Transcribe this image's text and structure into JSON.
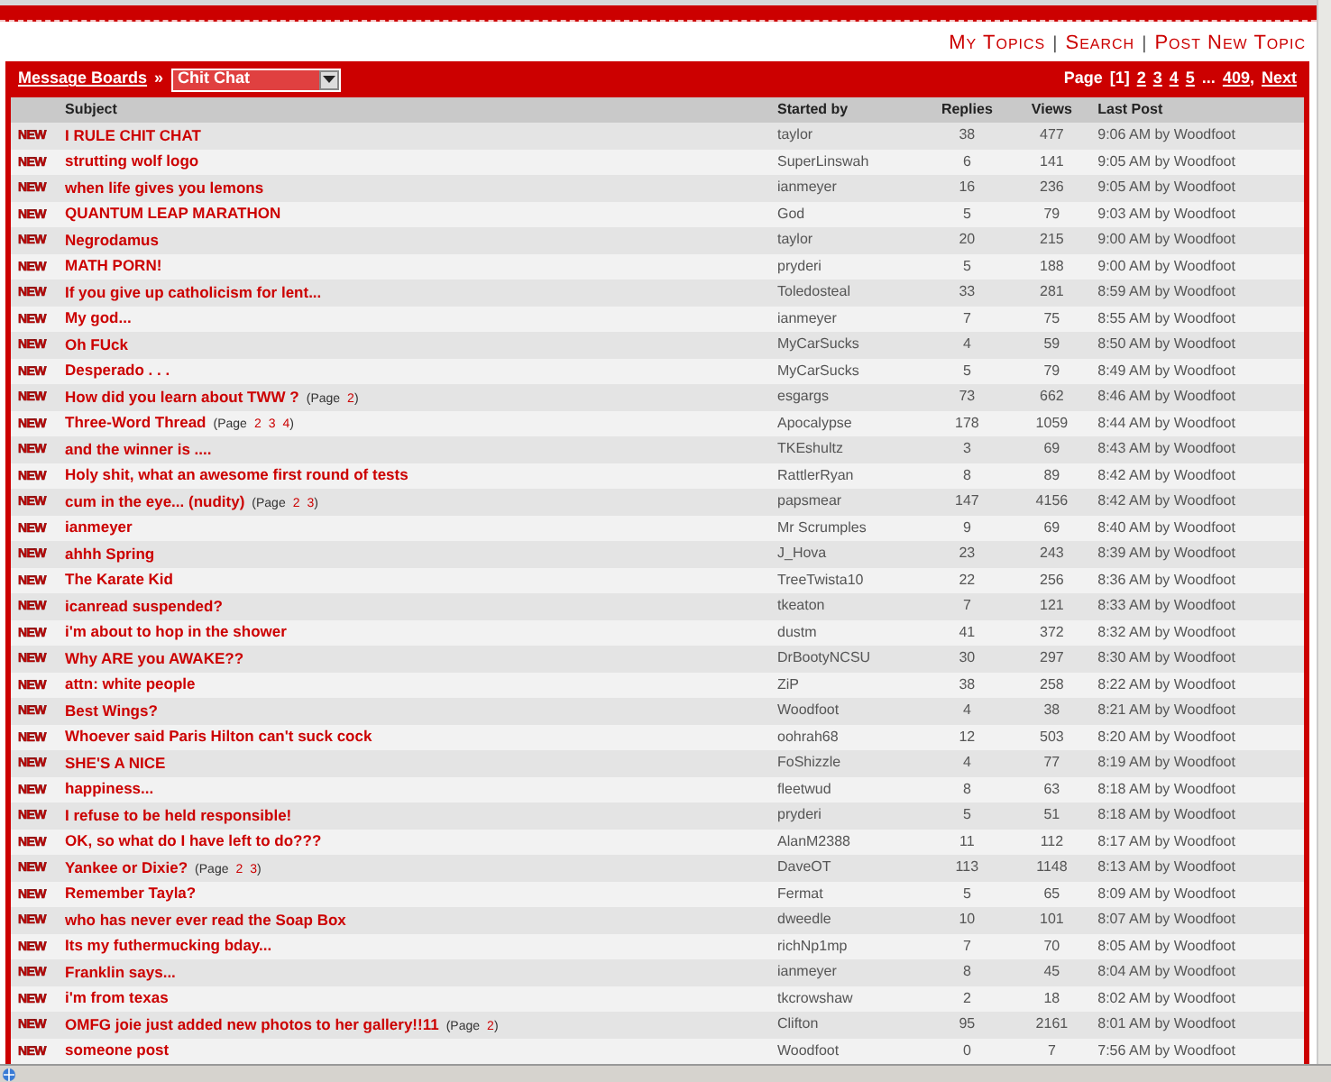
{
  "top_links": {
    "links": [
      {
        "label": "My Topics"
      },
      {
        "label": "Search"
      },
      {
        "label": "Post New Topic"
      }
    ],
    "separators": [
      "|",
      "|"
    ]
  },
  "board_bar": {
    "breadcrumb": "Message Boards",
    "arrow": "»",
    "forum_select": {
      "value": "Chit Chat"
    },
    "pagination": {
      "label": "Page",
      "pages": [
        {
          "label": "[1]",
          "selected": true
        },
        {
          "label": "2",
          "selected": false
        },
        {
          "label": "3",
          "selected": false
        },
        {
          "label": "4",
          "selected": false
        },
        {
          "label": "5",
          "selected": false
        }
      ],
      "ellipsis": "...",
      "last": "409",
      "separator": ",",
      "next": "Next"
    }
  },
  "table": {
    "columns": [
      "Subject",
      "Started by",
      "Replies",
      "Views",
      "Last Post"
    ],
    "rows": [
      {
        "badge": "NEW",
        "subject": "I RULE CHIT CHAT",
        "started_by": "taylor",
        "replies": "38",
        "views": "477",
        "last_post": "9:06 AM by Woodfoot"
      },
      {
        "badge": "NEW",
        "subject": "strutting wolf logo",
        "started_by": "SuperLinswah",
        "replies": "6",
        "views": "141",
        "last_post": "9:05 AM by Woodfoot"
      },
      {
        "badge": "NEW",
        "subject": "when life gives you lemons",
        "started_by": "ianmeyer",
        "replies": "16",
        "views": "236",
        "last_post": "9:05 AM by Woodfoot"
      },
      {
        "badge": "NEW",
        "subject": "QUANTUM LEAP MARATHON",
        "started_by": "God",
        "replies": "5",
        "views": "79",
        "last_post": "9:03 AM by Woodfoot"
      },
      {
        "badge": "NEW",
        "subject": "Negrodamus",
        "started_by": "taylor",
        "replies": "20",
        "views": "215",
        "last_post": "9:00 AM by Woodfoot"
      },
      {
        "badge": "NEW",
        "subject": "MATH PORN!",
        "started_by": "pryderi",
        "replies": "5",
        "views": "188",
        "last_post": "9:00 AM by Woodfoot"
      },
      {
        "badge": "NEW",
        "subject": "If you give up catholicism for lent...",
        "started_by": "Toledosteal",
        "replies": "33",
        "views": "281",
        "last_post": "8:59 AM by Woodfoot"
      },
      {
        "badge": "NEW",
        "subject": "My god...",
        "started_by": "ianmeyer",
        "replies": "7",
        "views": "75",
        "last_post": "8:55 AM by Woodfoot"
      },
      {
        "badge": "NEW",
        "subject": "Oh FUck",
        "started_by": "MyCarSucks",
        "replies": "4",
        "views": "59",
        "last_post": "8:50 AM by Woodfoot"
      },
      {
        "badge": "NEW",
        "subject": "Desperado . . .",
        "started_by": "MyCarSucks",
        "replies": "5",
        "views": "79",
        "last_post": "8:49 AM by Woodfoot"
      },
      {
        "badge": "NEW",
        "subject": "How did you learn about TWW ?",
        "page_links": {
          "open": "(Page",
          "pages": [
            "2"
          ],
          "close": ")"
        },
        "started_by": "esgargs",
        "replies": "73",
        "views": "662",
        "last_post": "8:46 AM by Woodfoot"
      },
      {
        "badge": "NEW",
        "subject": "Three-Word Thread",
        "page_links": {
          "open": "(Page",
          "pages": [
            "2",
            "3",
            "4"
          ],
          "close": ")"
        },
        "started_by": "Apocalypse",
        "replies": "178",
        "views": "1059",
        "last_post": "8:44 AM by Woodfoot"
      },
      {
        "badge": "NEW",
        "subject": "and the winner is ....",
        "started_by": "TKEshultz",
        "replies": "3",
        "views": "69",
        "last_post": "8:43 AM by Woodfoot"
      },
      {
        "badge": "NEW",
        "subject": "Holy shit, what an awesome first round of tests",
        "started_by": "RattlerRyan",
        "replies": "8",
        "views": "89",
        "last_post": "8:42 AM by Woodfoot"
      },
      {
        "badge": "NEW",
        "subject": "cum in the eye... (nudity)",
        "page_links": {
          "open": "(Page",
          "pages": [
            "2",
            "3"
          ],
          "close": ")"
        },
        "started_by": "papsmear",
        "replies": "147",
        "views": "4156",
        "last_post": "8:42 AM by Woodfoot"
      },
      {
        "badge": "NEW",
        "subject": "ianmeyer",
        "started_by": "Mr Scrumples",
        "replies": "9",
        "views": "69",
        "last_post": "8:40 AM by Woodfoot"
      },
      {
        "badge": "NEW",
        "subject": "ahhh Spring",
        "started_by": "J_Hova",
        "replies": "23",
        "views": "243",
        "last_post": "8:39 AM by Woodfoot"
      },
      {
        "badge": "NEW",
        "subject": "The Karate Kid",
        "started_by": "TreeTwista10",
        "replies": "22",
        "views": "256",
        "last_post": "8:36 AM by Woodfoot"
      },
      {
        "badge": "NEW",
        "subject": "icanread suspended?",
        "started_by": "tkeaton",
        "replies": "7",
        "views": "121",
        "last_post": "8:33 AM by Woodfoot"
      },
      {
        "badge": "NEW",
        "subject": "i'm about to hop in the shower",
        "started_by": "dustm",
        "replies": "41",
        "views": "372",
        "last_post": "8:32 AM by Woodfoot"
      },
      {
        "badge": "NEW",
        "subject": "Why ARE you AWAKE??",
        "started_by": "DrBootyNCSU",
        "replies": "30",
        "views": "297",
        "last_post": "8:30 AM by Woodfoot"
      },
      {
        "badge": "NEW",
        "subject": "attn: white people",
        "started_by": "ZiP",
        "replies": "38",
        "views": "258",
        "last_post": "8:22 AM by Woodfoot"
      },
      {
        "badge": "NEW",
        "subject": "Best Wings?",
        "started_by": "Woodfoot",
        "replies": "4",
        "views": "38",
        "last_post": "8:21 AM by Woodfoot"
      },
      {
        "badge": "NEW",
        "subject": "Whoever said Paris Hilton can't suck cock",
        "started_by": "oohrah68",
        "replies": "12",
        "views": "503",
        "last_post": "8:20 AM by Woodfoot"
      },
      {
        "badge": "NEW",
        "subject": "SHE'S A NICE",
        "started_by": "FoShizzle",
        "replies": "4",
        "views": "77",
        "last_post": "8:19 AM by Woodfoot"
      },
      {
        "badge": "NEW",
        "subject": "happiness...",
        "started_by": "fleetwud",
        "replies": "8",
        "views": "63",
        "last_post": "8:18 AM by Woodfoot"
      },
      {
        "badge": "NEW",
        "subject": "I refuse to be held responsible!",
        "started_by": "pryderi",
        "replies": "5",
        "views": "51",
        "last_post": "8:18 AM by Woodfoot"
      },
      {
        "badge": "NEW",
        "subject": "OK, so what do I have left to do???",
        "started_by": "AlanM2388",
        "replies": "11",
        "views": "112",
        "last_post": "8:17 AM by Woodfoot"
      },
      {
        "badge": "NEW",
        "subject": "Yankee or Dixie?",
        "page_links": {
          "open": "(Page",
          "pages": [
            "2",
            "3"
          ],
          "close": ")"
        },
        "started_by": "DaveOT",
        "replies": "113",
        "views": "1148",
        "last_post": "8:13 AM by Woodfoot"
      },
      {
        "badge": "NEW",
        "subject": "Remember Tayla?",
        "started_by": "Fermat",
        "replies": "5",
        "views": "65",
        "last_post": "8:09 AM by Woodfoot"
      },
      {
        "badge": "NEW",
        "subject": "who has never ever read the Soap Box",
        "started_by": "dweedle",
        "replies": "10",
        "views": "101",
        "last_post": "8:07 AM by Woodfoot"
      },
      {
        "badge": "NEW",
        "subject": "Its my futhermucking bday...",
        "started_by": "richNp1mp",
        "replies": "7",
        "views": "70",
        "last_post": "8:05 AM by Woodfoot"
      },
      {
        "badge": "NEW",
        "subject": "Franklin says...",
        "started_by": "ianmeyer",
        "replies": "8",
        "views": "45",
        "last_post": "8:04 AM by Woodfoot"
      },
      {
        "badge": "NEW",
        "subject": "i'm from texas",
        "started_by": "tkcrowshaw",
        "replies": "2",
        "views": "18",
        "last_post": "8:02 AM by Woodfoot"
      },
      {
        "badge": "NEW",
        "subject": "OMFG joie just added new photos to her gallery!!11",
        "page_links": {
          "open": "(Page",
          "pages": [
            "2"
          ],
          "close": ")"
        },
        "started_by": "Clifton",
        "replies": "95",
        "views": "2161",
        "last_post": "8:01 AM by Woodfoot"
      },
      {
        "badge": "NEW",
        "subject": "someone post",
        "started_by": "Woodfoot",
        "replies": "0",
        "views": "7",
        "last_post": "7:56 AM by Woodfoot"
      }
    ]
  }
}
